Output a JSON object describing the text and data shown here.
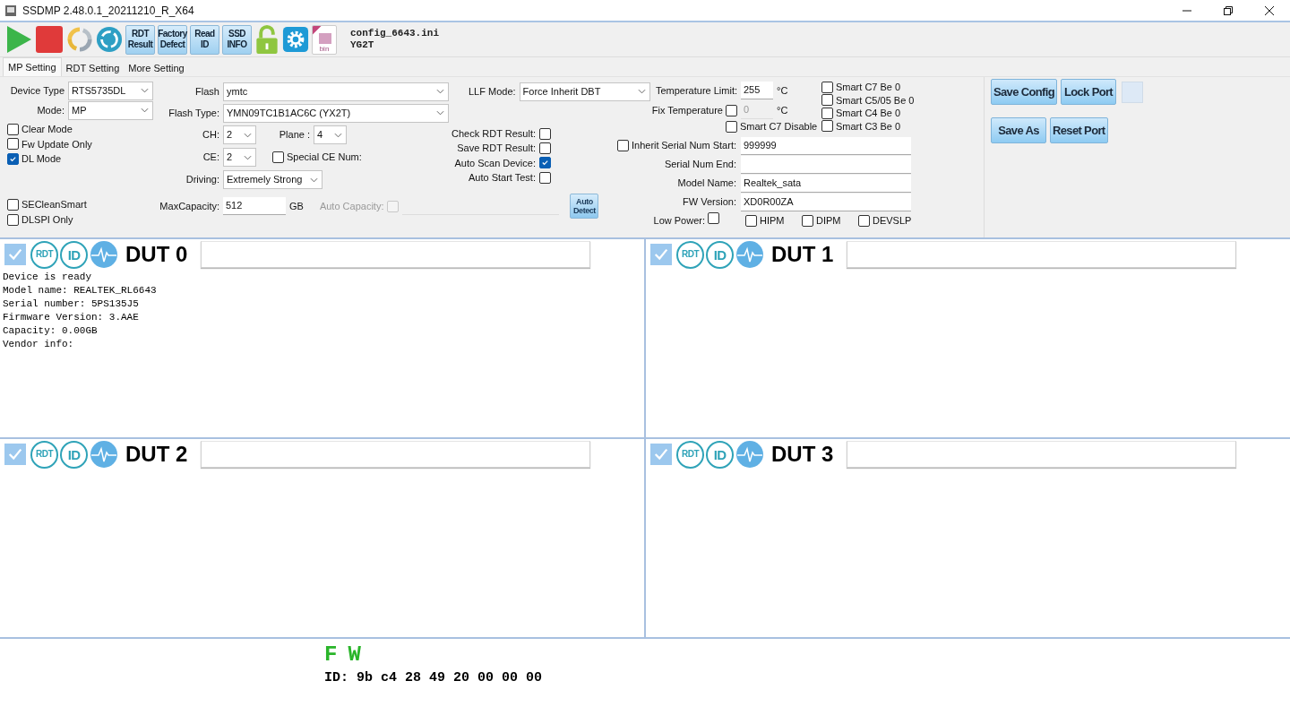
{
  "window": {
    "title": "SSDMP 2.48.0.1_20211210_R_X64"
  },
  "toolbar": {
    "buttons": [
      {
        "kind": "play"
      },
      {
        "kind": "stop"
      },
      {
        "kind": "refresh"
      },
      {
        "kind": "recycle"
      },
      {
        "kind": "text",
        "lines": [
          "RDT",
          "Result"
        ]
      },
      {
        "kind": "text",
        "lines": [
          "Factory",
          "Defect"
        ]
      },
      {
        "kind": "text",
        "lines": [
          "Read",
          "ID"
        ]
      },
      {
        "kind": "text",
        "lines": [
          "SSD",
          "INFO"
        ]
      },
      {
        "kind": "lock"
      },
      {
        "kind": "gear"
      },
      {
        "kind": "file",
        "label": "bin"
      }
    ],
    "config": [
      "config_6643.ini",
      "YG2T"
    ]
  },
  "tabs": [
    {
      "label": "MP Setting",
      "selected": true
    },
    {
      "label": "RDT Setting",
      "selected": false
    },
    {
      "label": "More Setting",
      "selected": false
    }
  ],
  "settings": {
    "device_type": {
      "label": "Device Type",
      "value": "RTS5735DL"
    },
    "mode": {
      "label": "Mode:",
      "value": "MP"
    },
    "options": [
      {
        "label": "Clear Mode",
        "checked": false
      },
      {
        "label": "Fw Update Only",
        "checked": false
      },
      {
        "label": "DL Mode",
        "checked": true
      }
    ],
    "extra_options": [
      {
        "label": "SECleanSmart",
        "checked": false
      },
      {
        "label": "DLSPI Only",
        "checked": false
      }
    ],
    "flash": {
      "label": "Flash",
      "value": "ymtc"
    },
    "flash_type": {
      "label": "Flash Type:",
      "value": "YMN09TC1B1AC6C (YX2T)"
    },
    "ch": {
      "label": "CH:",
      "value": "2"
    },
    "plane": {
      "label": "Plane :",
      "value": "4"
    },
    "ce": {
      "label": "CE:",
      "value": "2"
    },
    "special_ce": {
      "label": "Special CE Num:",
      "checked": false
    },
    "driving": {
      "label": "Driving:",
      "value": "Extremely Strong"
    },
    "max_capacity": {
      "label": "MaxCapacity:",
      "value": "512",
      "unit": "GB"
    },
    "auto_capacity": {
      "label": "Auto Capacity:",
      "checked": false
    },
    "auto_detect": {
      "lines": [
        "Auto",
        "Detect"
      ]
    },
    "llf_mode": {
      "label": "LLF Mode:",
      "value": "Force Inherit DBT"
    },
    "rdt_options": [
      {
        "label": "Check RDT Result:",
        "checked": false
      },
      {
        "label": "Save RDT Result:",
        "checked": false
      },
      {
        "label": "Auto Scan Device:",
        "checked": true
      },
      {
        "label": "Auto Start Test:",
        "checked": false
      }
    ],
    "temperature_limit": {
      "label": "Temperature Limit:",
      "value": "255",
      "unit": "°C"
    },
    "fix_temperature": {
      "label": "Fix Temperature",
      "checked": false,
      "value": "0",
      "unit": "°C"
    },
    "smart_c7_disable": {
      "label": "Smart C7 Disable",
      "checked": false
    },
    "smart_options": [
      {
        "label": "Smart C7 Be 0",
        "checked": false
      },
      {
        "label": "Smart C5/05 Be 0",
        "checked": false
      },
      {
        "label": "Smart C4 Be 0",
        "checked": false
      },
      {
        "label": "Smart C3 Be 0",
        "checked": false
      }
    ],
    "inherit": {
      "label": "Inherit",
      "checked": false
    },
    "serial_fields": [
      {
        "label": "Serial Num Start:",
        "value": "999999"
      },
      {
        "label": "Serial Num End:"
      },
      {
        "label": "Model Name:",
        "value": "Realtek_sata"
      },
      {
        "label": "FW Version:",
        "value": "XD0R00ZA"
      }
    ],
    "low_power": {
      "label": "Low Power:",
      "checked": false
    },
    "power_options": [
      {
        "label": "HIPM",
        "checked": false
      },
      {
        "label": "DIPM",
        "checked": false
      },
      {
        "label": "DEVSLP",
        "checked": false
      }
    ]
  },
  "actions": [
    [
      "Save Config",
      "Lock Port"
    ],
    [
      "Save As",
      "Reset Port"
    ]
  ],
  "duts": [
    {
      "title": "DUT 0",
      "checked": true,
      "badges": [
        "RDT",
        "ID"
      ],
      "log": [
        "Device is ready",
        "Model name: REALTEK_RL6643",
        "Serial number: 5PS135J5",
        "Firmware Version: 3.AAE",
        "Capacity: 0.00GB",
        "Vendor info:"
      ]
    },
    {
      "title": "DUT 1",
      "checked": true,
      "badges": [
        "RDT",
        "ID"
      ]
    },
    {
      "title": "DUT 2",
      "checked": true,
      "badges": [
        "RDT",
        "ID"
      ]
    },
    {
      "title": "DUT 3",
      "checked": true,
      "badges": [
        "RDT",
        "ID"
      ]
    }
  ],
  "footer": {
    "flags": [
      "F",
      "W"
    ],
    "id": "ID: 9b c4 28 49 20 00 00 00"
  }
}
